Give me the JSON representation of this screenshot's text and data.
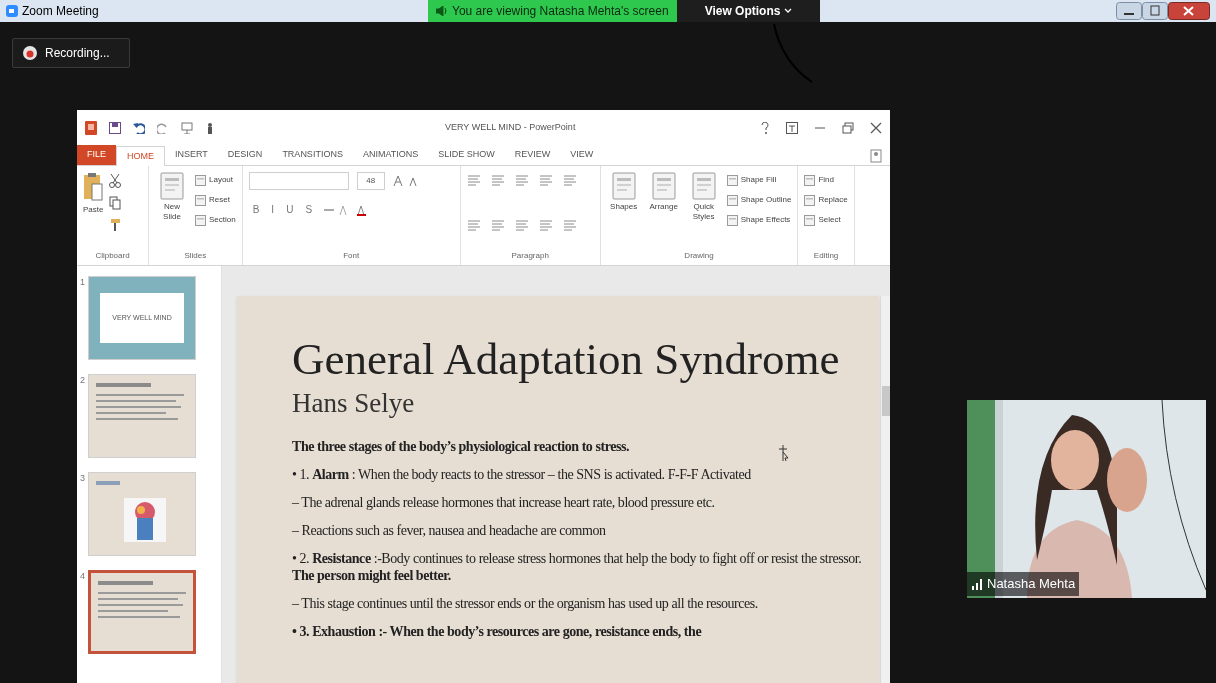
{
  "window": {
    "title": "Zoom Meeting"
  },
  "share_banner": {
    "text": "You are viewing Natasha Mehta's screen"
  },
  "view_options": {
    "label": "View Options"
  },
  "recording": {
    "label": "Recording..."
  },
  "powerpoint": {
    "title": "VERY WELL MIND - PowerPoint",
    "tabs": [
      {
        "label": "FILE",
        "kind": "file",
        "selected": false
      },
      {
        "label": "HOME",
        "kind": "tab",
        "selected": true
      },
      {
        "label": "INSERT",
        "kind": "tab",
        "selected": false
      },
      {
        "label": "DESIGN",
        "kind": "tab",
        "selected": false
      },
      {
        "label": "TRANSITIONS",
        "kind": "tab",
        "selected": false
      },
      {
        "label": "ANIMATIONS",
        "kind": "tab",
        "selected": false
      },
      {
        "label": "SLIDE SHOW",
        "kind": "tab",
        "selected": false
      },
      {
        "label": "REVIEW",
        "kind": "tab",
        "selected": false
      },
      {
        "label": "VIEW",
        "kind": "tab",
        "selected": false
      }
    ],
    "groups": [
      {
        "label": "Clipboard",
        "kind": "clipboard",
        "buttons": [
          {
            "label": "Paste"
          }
        ]
      },
      {
        "label": "Slides",
        "kind": "buttons",
        "buttons": [
          {
            "label": "New Slide",
            "kind": "large"
          },
          {
            "label": "Layout",
            "kind": "small"
          },
          {
            "label": "Reset",
            "kind": "small"
          },
          {
            "label": "Section",
            "kind": "small"
          }
        ]
      },
      {
        "label": "Font",
        "kind": "font",
        "font_size": "48",
        "format_buttons": [
          "B",
          "I",
          "U",
          "S"
        ]
      },
      {
        "label": "Paragraph",
        "kind": "paragraph"
      },
      {
        "label": "Drawing",
        "kind": "buttons",
        "buttons": [
          {
            "label": "Shapes",
            "kind": "large"
          },
          {
            "label": "Arrange",
            "kind": "large"
          },
          {
            "label": "Quick Styles",
            "kind": "large"
          },
          {
            "label": "Shape Fill",
            "kind": "small"
          },
          {
            "label": "Shape Outline",
            "kind": "small"
          },
          {
            "label": "Shape Effects",
            "kind": "small"
          }
        ]
      },
      {
        "label": "Editing",
        "kind": "buttons",
        "buttons": [
          {
            "label": "Find",
            "kind": "small"
          },
          {
            "label": "Replace",
            "kind": "small"
          },
          {
            "label": "Select",
            "kind": "small"
          }
        ]
      }
    ],
    "slides": [
      {
        "number": "1",
        "kind": "title",
        "title": "VERY WELL MIND",
        "selected": false
      },
      {
        "number": "2",
        "kind": "text",
        "selected": false
      },
      {
        "number": "3",
        "selected": false
      },
      {
        "number": "4",
        "kind": "text",
        "selected": true
      }
    ],
    "slide": {
      "title": "General Adaptation Syndrome",
      "subtitle": "Hans Selye",
      "paragraphs": [
        {
          "text": "The three stages of the body’s physiological reaction  to stress.",
          "kind": "bold"
        },
        {
          "text": "• 1. **Alarm** : When the body reacts to the stressor – the SNS is  activated.  F-F-F Activated",
          "kind": "plain"
        },
        {
          "text": "– The adrenal glands release hormones that increase  heart rate, blood pressure etc.",
          "kind": "plain"
        },
        {
          "text": "– Reactions such as fever, nausea and headache are  common",
          "kind": "plain"
        },
        {
          "text": "• 2. **Resistance** :-Body continues to release stress hormones that  help the body to fight off or resist the stressor. **The person might  feel better.**",
          "kind": "plain"
        },
        {
          "text": "– This stage continues until the stressor ends or the  organism has used up all the resources.",
          "kind": "plain"
        },
        {
          "text": "• 3. Exhaustion :- When the body’s resources  are gone, resistance ends, the",
          "kind": "bold"
        }
      ]
    }
  },
  "video": {
    "name": "Natasha Mehta"
  }
}
